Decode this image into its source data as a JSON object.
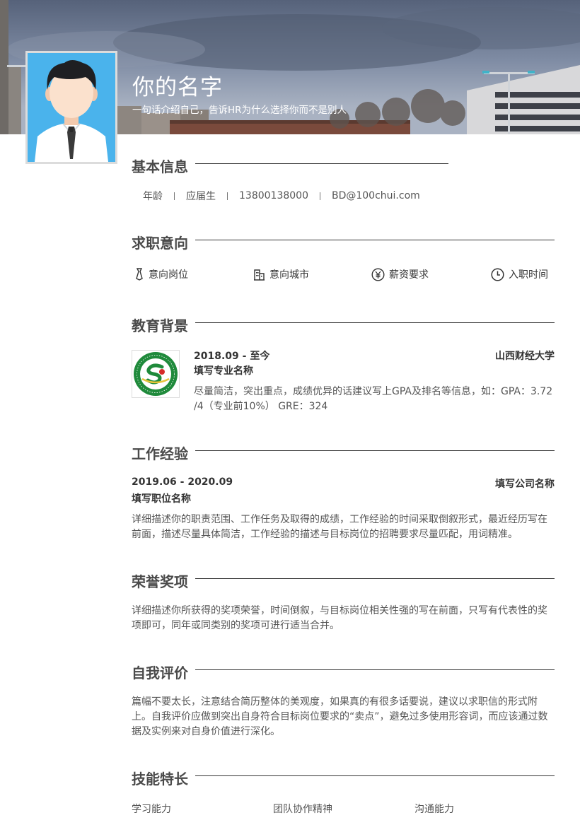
{
  "header": {
    "name": "你的名字",
    "slogan": "一句话介绍自己，告诉HR为什么选择你而不是别人"
  },
  "sections": {
    "basic": "基本信息",
    "intent": "求职意向",
    "education": "教育背景",
    "work": "工作经验",
    "honors": "荣誉奖项",
    "self": "自我评价",
    "skills": "技能特长"
  },
  "basic_info": [
    "年龄",
    "应届生",
    "13800138000",
    "BD@100chui.com"
  ],
  "intent_items": [
    {
      "label": "意向岗位",
      "icon": "tie-icon"
    },
    {
      "label": "意向城市",
      "icon": "building-icon"
    },
    {
      "label": "薪资要求",
      "icon": "yen-icon"
    },
    {
      "label": "入职时间",
      "icon": "clock-icon"
    }
  ],
  "education": {
    "date": "2018.09 - 至今",
    "school": "山西财经大学",
    "major": "填写专业名称",
    "desc": "尽量简洁，突出重点，成绩优异的话建议写上GPA及排名等信息，如：GPA：3.72 /4（专业前10%） GRE：324"
  },
  "work": {
    "date": "2019.06 - 2020.09",
    "company": "填写公司名称",
    "position": "填写职位名称",
    "desc": "详细描述你的职责范围、工作任务及取得的成绩，工作经验的时间采取倒叙形式，最近经历写在前面，描述尽量具体简洁，工作经验的描述与目标岗位的招聘要求尽量匹配，用词精准。"
  },
  "honors": {
    "desc": "详细描述你所获得的奖项荣誉，时间倒叙，与目标岗位相关性强的写在前面，只写有代表性的奖项即可，同年或同类别的奖项可进行适当合并。"
  },
  "self": {
    "desc": "篇幅不要太长，注意结合简历整体的美观度，如果真的有很多话要说，建议以求职信的形式附上。自我评价应做到突出自身符合目标岗位要求的“卖点”，避免过多使用形容词，而应该通过数据及实例来对自身价值进行深化。"
  },
  "skills": [
    "学习能力",
    "团队协作精神",
    "沟通能力"
  ],
  "colors": {
    "accent": "#333333",
    "text": "#555555",
    "avatar_bg": "#4ab3ec"
  }
}
